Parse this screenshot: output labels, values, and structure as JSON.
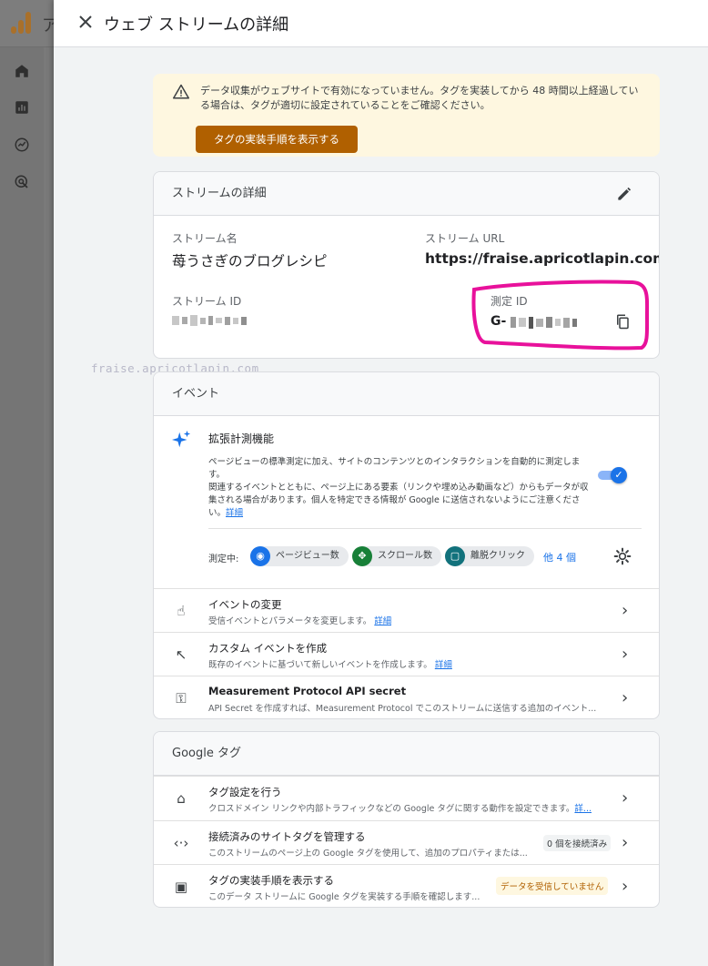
{
  "background": {
    "app_title": "ア"
  },
  "panel": {
    "title": "ウェブ ストリームの詳細"
  },
  "warning": {
    "text": "データ収集がウェブサイトで有効になっていません。タグを実装してから 48 時間以上経過している場合は、タグが適切に設定されていることをご確認ください。",
    "button": "タグの実装手順を表示する"
  },
  "stream_details": {
    "header": "ストリームの詳細",
    "name_label": "ストリーム名",
    "name_value": "苺うさぎのブログレシピ",
    "url_label": "ストリーム URL",
    "url_value": "https://fraise.apricotlapin.com",
    "id_label": "ストリーム ID",
    "measurement_label": "測定 ID",
    "measurement_prefix": "G-"
  },
  "watermark": "fraise.apricotlapin.com",
  "events": {
    "header": "イベント",
    "enhanced_title": "拡張計測機能",
    "enhanced_desc1": "ページビューの標準測定に加え、サイトのコンテンツとのインタラクションを自動的に測定します。",
    "enhanced_desc2": "関連するイベントとともに、ページ上にある要素（リンクや埋め込み動画など）からもデータが収集される場合があります。個人を特定できる情報が Google に送信されないようにご注意ください。",
    "details_link": "詳細",
    "measuring_label": "測定中:",
    "chips": [
      "ページビュー数",
      "スクロール数",
      "離脱クリック"
    ],
    "more": "他 4 個",
    "rows": [
      {
        "title": "イベントの変更",
        "sub": "受信イベントとパラメータを変更します。",
        "link": "詳細"
      },
      {
        "title": "カスタム イベントを作成",
        "sub": "既存のイベントに基づいて新しいイベントを作成します。",
        "link": "詳細"
      },
      {
        "title": "Measurement Protocol API secret",
        "sub": "API Secret を作成すれば、Measurement Protocol でこのストリームに送信する追加のイベント..."
      }
    ]
  },
  "google_tag": {
    "header": "Google タグ",
    "rows": [
      {
        "title": "タグ設定を行う",
        "sub": "クロスドメイン リンクや内部トラフィックなどの Google タグに関する動作を設定できます。",
        "link": "詳..."
      },
      {
        "title": "接続済みのサイトタグを管理する",
        "sub": "このストリームのページ上の Google タグを使用して、追加のプロパティまたは...",
        "badge": "0 個を接続済み"
      },
      {
        "title": "タグの実装手順を表示する",
        "sub": "このデータ ストリームに Google タグを実装する手順を確認します...",
        "badge": "データを受信していません"
      }
    ]
  },
  "colors": {
    "accent": "#1a73e8",
    "warning_bg": "#fef7e0",
    "warning_button": "#b06000",
    "highlight": "#e8119b"
  }
}
